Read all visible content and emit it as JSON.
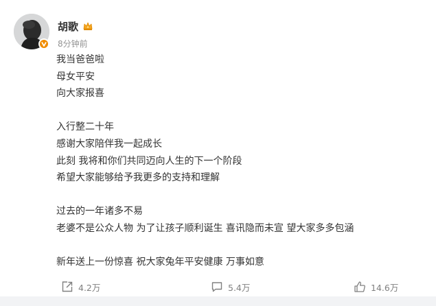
{
  "post": {
    "author": {
      "name": "胡歌",
      "avatar_icon": "avatar",
      "verified_icon": "verified-v-icon",
      "member_icon": "crown-icon"
    },
    "time": "8分钟前",
    "lines": [
      "我当爸爸啦",
      "母女平安",
      "向大家报喜",
      "",
      "入行整二十年",
      "感谢大家陪伴我一起成长",
      "此刻 我将和你们共同迈向人生的下一个阶段",
      "希望大家能够给予我更多的支持和理解",
      "",
      "过去的一年诸多不易",
      "老婆不是公众人物 为了让孩子顺利诞生 喜讯隐而未宣 望大家多多包涵",
      "",
      "新年送上一份惊喜 祝大家兔年平安健康 万事如意"
    ]
  },
  "actions": {
    "repost": {
      "icon": "repost-icon",
      "count": "4.2万"
    },
    "comment": {
      "icon": "comment-icon",
      "count": "5.4万"
    },
    "like": {
      "icon": "thumbs-up-icon",
      "count": "14.6万"
    }
  },
  "colors": {
    "text": "#333333",
    "muted": "#939393",
    "badge": "#f08c00",
    "divider": "#f2f3f5"
  }
}
